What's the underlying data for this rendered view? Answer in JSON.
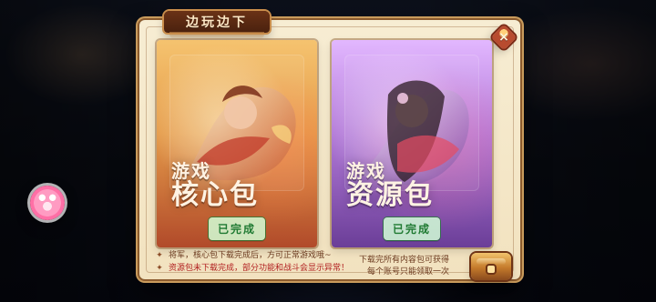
{
  "dialog": {
    "title": "边玩边下",
    "close_icon": "close-icon"
  },
  "packs": [
    {
      "id": "core",
      "title_line1": "游戏",
      "title_line2": "核心包",
      "status": "已完成",
      "accent": "#e59b4a",
      "status_color": "#1f7a32"
    },
    {
      "id": "resources",
      "title_line1": "游戏",
      "title_line2": "资源包",
      "status": "已完成",
      "accent": "#b27ad8",
      "status_color": "#1f7a32"
    }
  ],
  "notes": {
    "left_lines": [
      "将军，核心包下载完成后，方可正常游戏哦~",
      "资源包未下载完成，部分功能和战斗会显示异常！"
    ],
    "right_lines": [
      "下载完所有内容包可获得",
      "每个账号只能领取一次"
    ]
  },
  "icons": {
    "avatar": "avatar-icon",
    "chest": "treasure-chest-icon"
  }
}
